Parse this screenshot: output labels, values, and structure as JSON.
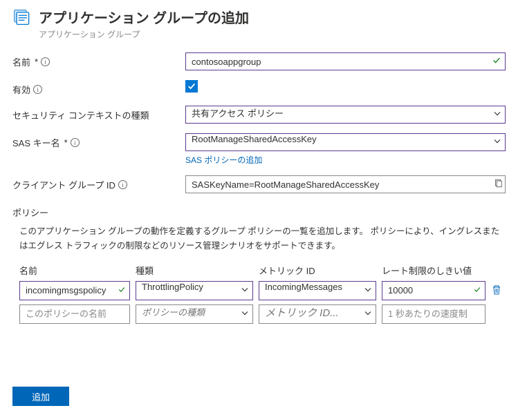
{
  "header": {
    "title": "アプリケーション グループの追加",
    "subtitle": "アプリケーション グループ"
  },
  "labels": {
    "name": "名前",
    "enabled": "有効",
    "secContextType": "セキュリティ コンテキストの種類",
    "sasKeyName": "SAS キー名",
    "addSasPolicy": "SAS ポリシーの追加",
    "clientGroupId": "クライアント グループ ID",
    "policySection": "ポリシー",
    "policyDesc": "このアプリケーション グループの動作を定義するグループ ポリシーの一覧を追加します。 ポリシーにより、イングレスまたはエグレス トラフィックの制限などのリソース管理シナリオをサポートできます。",
    "colName": "名前",
    "colType": "種類",
    "colMetric": "メトリック ID",
    "colRate": "レート制限のしきい値",
    "placeholderPolicyName": "このポリシーの名前",
    "placeholderPolicyType": "ポリシーの種類",
    "placeholderMetric": "メトリック ID...",
    "placeholderRate": "1 秒あたりの速度制限",
    "submit": "追加"
  },
  "values": {
    "name": "contosoappgroup",
    "secContextType": "共有アクセス ポリシー",
    "sasKeyName": "RootManageSharedAccessKey",
    "clientGroupId": "SASKeyName=RootManageSharedAccessKey"
  },
  "policies": [
    {
      "name": "incomingmsgspolicy",
      "type": "ThrottlingPolicy",
      "metric": "IncomingMessages",
      "rate": "10000"
    }
  ]
}
